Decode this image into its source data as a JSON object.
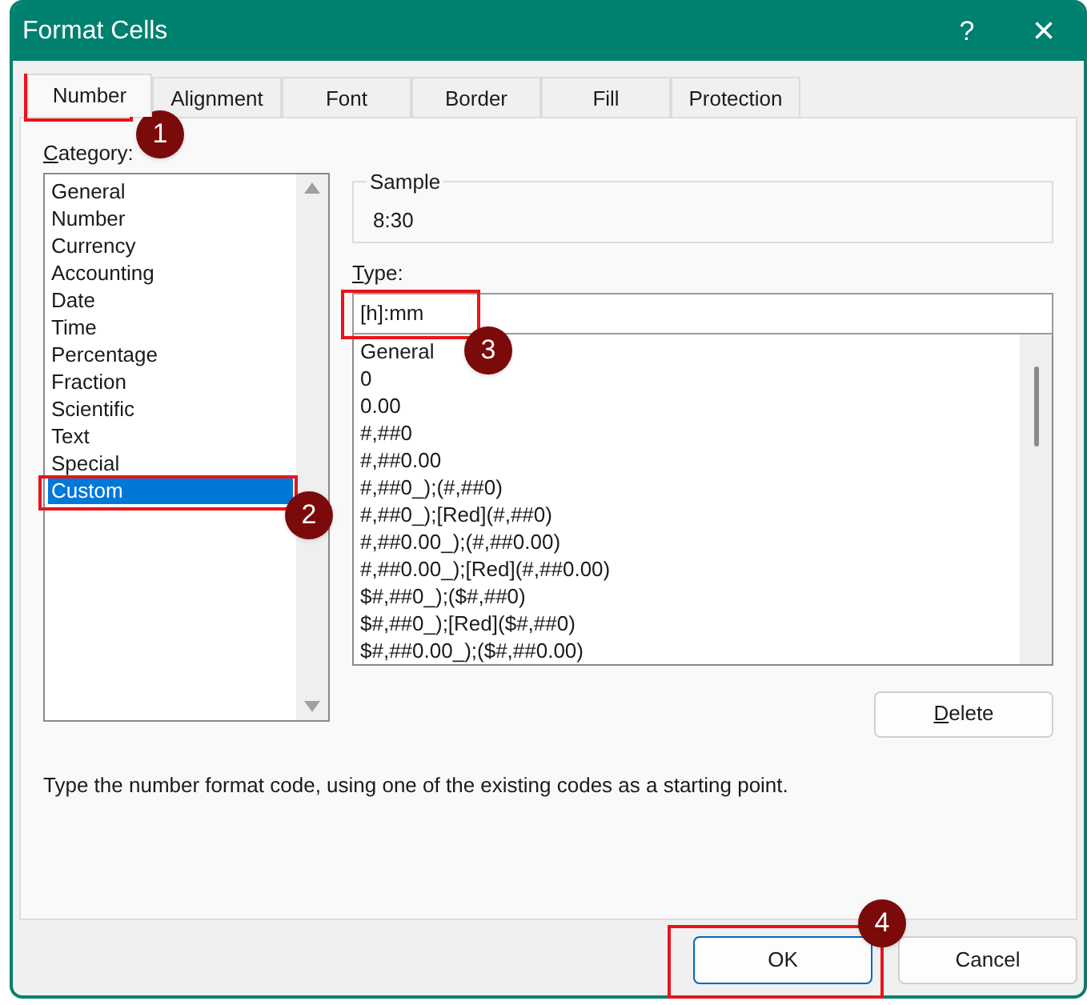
{
  "window": {
    "title": "Format Cells",
    "help": "?",
    "close": "×"
  },
  "tabs": [
    {
      "label": "Number",
      "selected": true
    },
    {
      "label": "Alignment",
      "selected": false
    },
    {
      "label": "Font",
      "selected": false
    },
    {
      "label": "Border",
      "selected": false
    },
    {
      "label": "Fill",
      "selected": false
    },
    {
      "label": "Protection",
      "selected": false
    }
  ],
  "category": {
    "label": "Category:",
    "items": [
      {
        "label": "General",
        "selected": false
      },
      {
        "label": "Number",
        "selected": false
      },
      {
        "label": "Currency",
        "selected": false
      },
      {
        "label": "Accounting",
        "selected": false
      },
      {
        "label": "Date",
        "selected": false
      },
      {
        "label": "Time",
        "selected": false
      },
      {
        "label": "Percentage",
        "selected": false
      },
      {
        "label": "Fraction",
        "selected": false
      },
      {
        "label": "Scientific",
        "selected": false
      },
      {
        "label": "Text",
        "selected": false
      },
      {
        "label": "Special",
        "selected": false
      },
      {
        "label": "Custom",
        "selected": true
      }
    ]
  },
  "sample": {
    "label": "Sample",
    "value": "8:30"
  },
  "type": {
    "label": "Type:",
    "value": "[h]:mm",
    "formats": [
      "General",
      "0",
      "0.00",
      "#,##0",
      "#,##0.00",
      "#,##0_);(#,##0)",
      "#,##0_);[Red](#,##0)",
      "#,##0.00_);(#,##0.00)",
      "#,##0.00_);[Red](#,##0.00)",
      "$#,##0_);($#,##0)",
      "$#,##0_);[Red]($#,##0)",
      "$#,##0.00_);($#,##0.00)"
    ]
  },
  "delete_button": "Delete",
  "description": "Type the number format code, using one of the existing codes as a starting point.",
  "buttons": [
    {
      "label": "OK",
      "kind": "primary"
    },
    {
      "label": "Cancel",
      "kind": "normal"
    }
  ],
  "callouts": [
    "1",
    "2",
    "3",
    "4"
  ]
}
